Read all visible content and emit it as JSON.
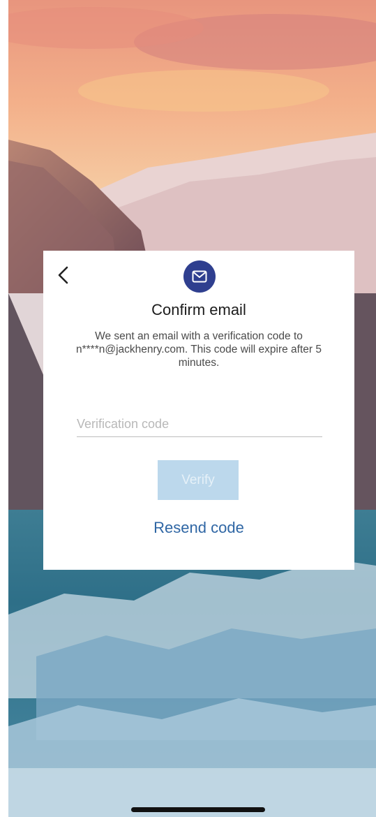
{
  "dialog": {
    "title": "Confirm email",
    "description": "We sent an email with a verification code to n****n@jackhenry.com. This code will expire after 5 minutes.",
    "code_placeholder": "Verification code",
    "code_value": "",
    "verify_label": "Verify",
    "verify_enabled": false,
    "resend_label": "Resend code"
  },
  "icons": {
    "back": "chevron-left-icon",
    "mail": "envelope-icon"
  },
  "colors": {
    "badge": "#2f3f8f",
    "verify_disabled": "#bcd8ec",
    "link": "#2f66a4"
  }
}
